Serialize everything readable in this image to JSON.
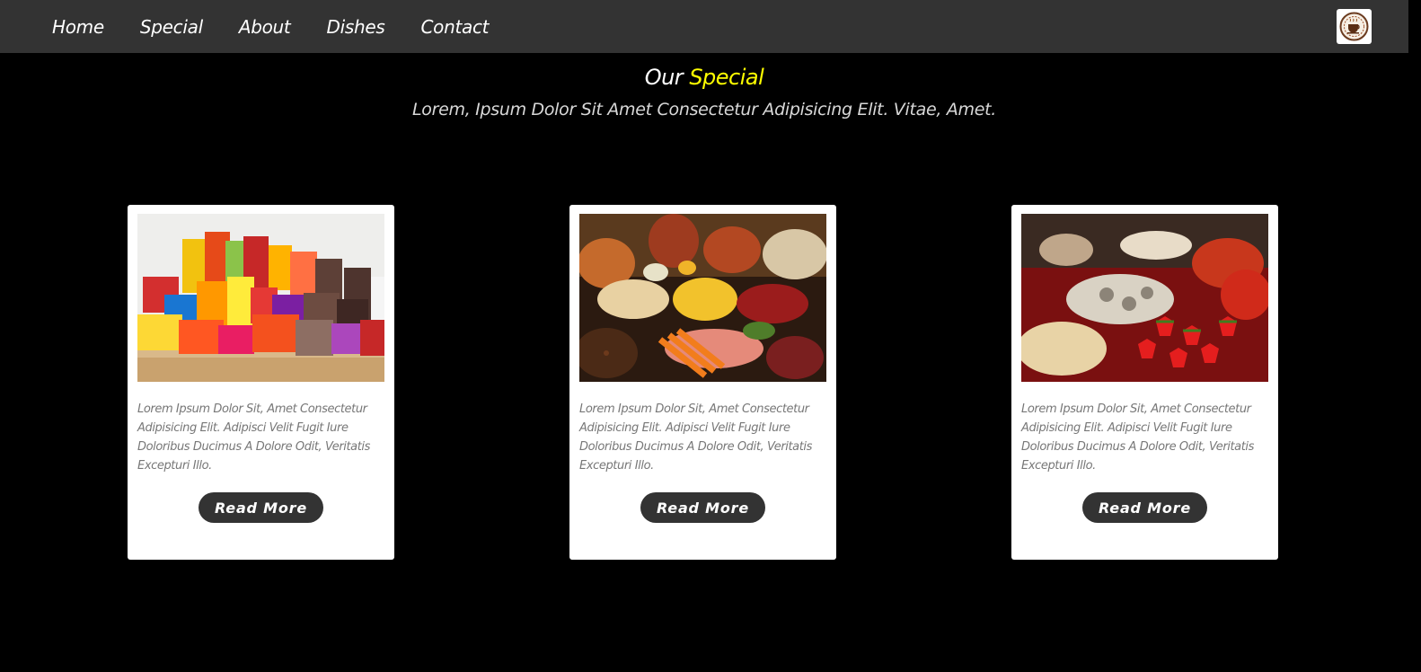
{
  "nav": {
    "items": [
      "Home",
      "Special",
      "About",
      "Dishes",
      "Contact"
    ]
  },
  "logo": {
    "icon": "coffee-cup-logo"
  },
  "section": {
    "title_prefix": "Our",
    "title_accent": "Special",
    "subtitle": "Lorem, Ipsum Dolor Sit Amet Consectetur Adipisicing Elit. Vitae, Amet."
  },
  "cards": [
    {
      "image": "packaged-snacks-image",
      "text": "Lorem Ipsum Dolor Sit, Amet Consectetur Adipisicing Elit. Adipisci Velit Fugit Iure Doloribus Ducimus A Dolore Odit, Veritatis Excepturi Illo.",
      "button": "Read More"
    },
    {
      "image": "fresh-foods-image",
      "text": "Lorem Ipsum Dolor Sit, Amet Consectetur Adipisicing Elit. Adipisci Velit Fugit Iure Doloribus Ducimus A Dolore Odit, Veritatis Excepturi Illo.",
      "button": "Read More"
    },
    {
      "image": "fruit-platter-image",
      "text": "Lorem Ipsum Dolor Sit, Amet Consectetur Adipisicing Elit. Adipisci Velit Fugit Iure Doloribus Ducimus A Dolore Odit, Veritatis Excepturi Illo.",
      "button": "Read More"
    }
  ],
  "colors": {
    "navbar": "#333333",
    "background": "#000000",
    "accent": "#ffff00",
    "button": "#333333"
  }
}
